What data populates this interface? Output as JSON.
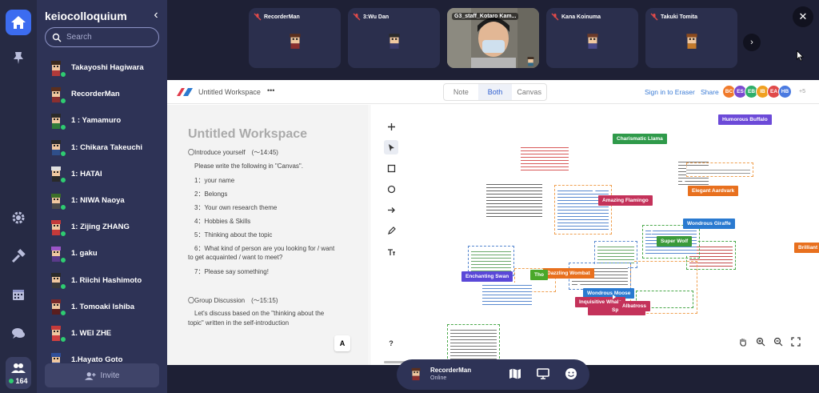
{
  "space": {
    "name": "keiocolloquium",
    "search_placeholder": "Search",
    "users": [
      {
        "name": "Takayoshi Hagiwara",
        "hair": "#3b2a1e",
        "shirt": "#b03a3a"
      },
      {
        "name": "RecorderMan",
        "hair": "#5a2f1e",
        "shirt": "#8a2f2f"
      },
      {
        "name": "1 : Yamamuro",
        "hair": "#2a2a2a",
        "shirt": "#2f7a3a"
      },
      {
        "name": "1: Chikara Takeuchi",
        "hair": "#2a2a2a",
        "shirt": "#2f4f8a"
      },
      {
        "name": "1: HATAI",
        "hair": "#e0e0e0",
        "shirt": "#2a2a2a"
      },
      {
        "name": "1: NIWA Naoya",
        "hair": "#3b6f2a",
        "shirt": "#4a4a4a"
      },
      {
        "name": "1: Zijing ZHANG",
        "hair": "#c43a3a",
        "shirt": "#c43a3a"
      },
      {
        "name": "1. gaku",
        "hair": "#9a54c8",
        "shirt": "#5a3a8a"
      },
      {
        "name": "1. Riichi Hashimoto",
        "hair": "#2a2a2a",
        "shirt": "#3a3a3a"
      },
      {
        "name": "1. Tomoaki Ishiba",
        "hair": "#7a2a2a",
        "shirt": "#5a1e1e"
      },
      {
        "name": "1. WEI ZHE",
        "hair": "#c43a3a",
        "shirt": "#d04040"
      },
      {
        "name": "1.Hayato Goto",
        "hair": "#2f4f9a",
        "shirt": "#2f4f9a"
      }
    ],
    "invite_label": "Invite",
    "online_count": "164"
  },
  "video_tiles": [
    {
      "name": "RecorderMan",
      "muted": true
    },
    {
      "name": "3:Wu Dan",
      "muted": true
    },
    {
      "name": "G3_staff_Kotaro Kam...",
      "muted": false
    },
    {
      "name": "Kana Koinuma",
      "muted": true
    },
    {
      "name": "Takuki Tomita",
      "muted": true
    }
  ],
  "eraser": {
    "workspace_title": "Untitled Workspace",
    "menu_label": "•••",
    "tabs": [
      "Note",
      "Both",
      "Canvas"
    ],
    "active_tab": "Both",
    "sign_in": "Sign in to Eraser",
    "share": "Share",
    "collaborators": [
      {
        "initials": "BC",
        "color": "#f07a2a"
      },
      {
        "initials": "ES",
        "color": "#7a4ad0"
      },
      {
        "initials": "EB",
        "color": "#2fae6a"
      },
      {
        "initials": "IB",
        "color": "#f0a020"
      },
      {
        "initials": "EA",
        "color": "#e04a4a"
      },
      {
        "initials": "HB",
        "color": "#4a7ae0"
      }
    ],
    "more_collaborators": "+5",
    "doc": {
      "title": "Untitled Workspace",
      "lines": [
        "〇Introduce yourself　(〜14:45)",
        "Please write the following in \"Canvas\".",
        "1：your name",
        "2：Belongs",
        "3：Your own research theme",
        "4：Hobbies & Skills",
        "5：Thinking about the topic",
        "6：What kind of person are you looking for / want",
        "to get acquainted / want to meet?",
        "7：Please say something!",
        "〇Group Discussion　(〜15:15)",
        "Let's discuss based on the \"thinking about the",
        "topic\" written in the self-introduction"
      ],
      "font_button": "A"
    },
    "help_label": "?",
    "flags": [
      {
        "text": "Humorous Buffalo",
        "color": "#6c4ad8"
      },
      {
        "text": "Charismatic Llama",
        "color": "#2f9a4a"
      },
      {
        "text": "Elegant Aardvark",
        "color": "#e8701e"
      },
      {
        "text": "Amazing Flamingo",
        "color": "#c4325a"
      },
      {
        "text": "Wondrous Giraffe",
        "color": "#2a7ad0"
      },
      {
        "text": "Super Wolf",
        "color": "#3a9a3a"
      },
      {
        "text": "Brilliant Ca",
        "color": "#e8701e"
      },
      {
        "text": "Enchanting Swan",
        "color": "#5a48d8"
      },
      {
        "text": "Dazzling Wombat",
        "color": "#e8701e"
      },
      {
        "text": "Tho",
        "color": "#4aa82a"
      },
      {
        "text": "Wondrous Moose",
        "color": "#2a7ad0"
      },
      {
        "text": "Inquisitive Whale",
        "color": "#c4325a"
      },
      {
        "text": "Albatross",
        "color": "#c4325a"
      },
      {
        "text": "Spectacular",
        "color": "#c4325a"
      }
    ]
  },
  "me": {
    "name": "RecorderMan",
    "status": "Online"
  }
}
